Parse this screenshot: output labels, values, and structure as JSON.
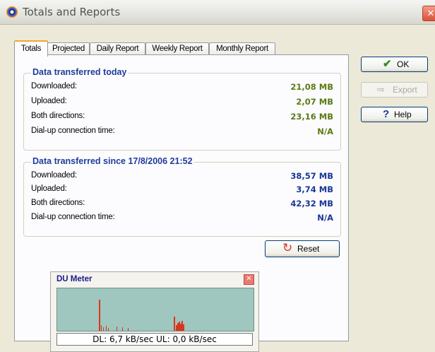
{
  "window": {
    "title": "Totals and Reports",
    "close_glyph": "✕"
  },
  "tabs": [
    {
      "label": "Totals",
      "active": true
    },
    {
      "label": "Projected",
      "active": false
    },
    {
      "label": "Daily Report",
      "active": false
    },
    {
      "label": "Weekly Report",
      "active": false
    },
    {
      "label": "Monthly Report",
      "active": false
    }
  ],
  "today": {
    "title": "Data transferred today",
    "rows": [
      {
        "label": "Downloaded:",
        "value": "21,08 MB"
      },
      {
        "label": "Uploaded:",
        "value": "2,07 MB"
      },
      {
        "label": "Both directions:",
        "value": "23,16 MB"
      },
      {
        "label": "Dial-up connection time:",
        "value": "N/A"
      }
    ],
    "value_color": "#5a7a14"
  },
  "since": {
    "title": "Data transferred since 17/8/2006 21:52",
    "rows": [
      {
        "label": "Downloaded:",
        "value": "38,57 MB"
      },
      {
        "label": "Uploaded:",
        "value": "3,74 MB"
      },
      {
        "label": "Both directions:",
        "value": "42,32 MB"
      },
      {
        "label": "Dial-up connection time:",
        "value": "N/A"
      }
    ],
    "value_color": "#1a3696"
  },
  "buttons": {
    "ok": {
      "label": "OK",
      "icon": "checkmark-icon"
    },
    "export": {
      "label": "Export",
      "icon": "export-icon",
      "disabled": true
    },
    "help": {
      "label": "Help",
      "icon": "question-mark-icon"
    },
    "reset": {
      "label": "Reset",
      "icon": "refresh-icon"
    }
  },
  "du_meter": {
    "title": "DU Meter",
    "status": "DL: 6,7 kB/sec  UL: 0,0 kB/sec",
    "graph_color": "#9fc6bf",
    "bar_color": "#d9361c"
  }
}
